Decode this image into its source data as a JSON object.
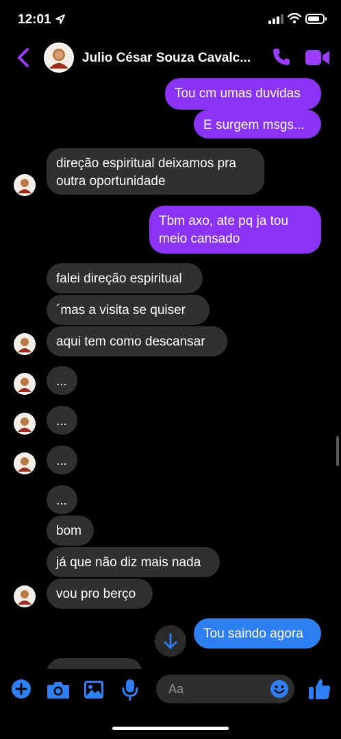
{
  "status": {
    "time": "12:01"
  },
  "header": {
    "contact_name": "Julio César Souza Cavalc..."
  },
  "messages": {
    "m1": "Tou cm umas duvidas",
    "m2": "E surgem msgs...",
    "m3a": "direção espiritual deixamos pra",
    "m3b": "outra oportunidade",
    "m4a": "Tbm axo, ate pq ja tou",
    "m4b": "meio cansado",
    "m5": "falei direção espiritual",
    "m6": "´mas a visita se quiser",
    "m7": "aqui tem como descansar",
    "m8": "...",
    "m9": "...",
    "m10": "...",
    "m11": "...",
    "m12": "bom",
    "m13": "já que não diz mais nada",
    "m14": "vou pro berço",
    "m15": "Tou saindo agora"
  },
  "composer": {
    "placeholder": "Aa"
  },
  "colors": {
    "outgoing": "#8a33f5",
    "outgoing_latest": "#2e80f2",
    "incoming": "#303030",
    "accent": "#9b3cff"
  },
  "icons": [
    "location-arrow-icon",
    "signal-icon",
    "wifi-icon",
    "battery-icon",
    "back-chevron-icon",
    "phone-icon",
    "video-camera-icon",
    "arrow-down-icon",
    "plus-icon",
    "camera-icon",
    "image-icon",
    "microphone-icon",
    "emoji-icon",
    "thumbs-up-icon"
  ]
}
